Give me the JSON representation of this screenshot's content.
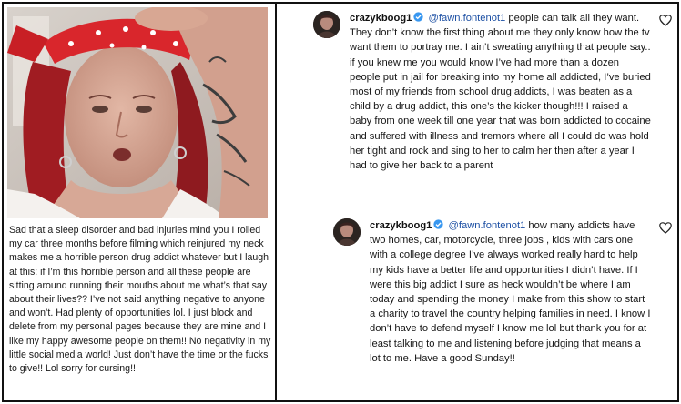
{
  "left_post": {
    "caption": "Sad that a sleep disorder and bad injuries mind you I rolled my car three months before filming which reinjured my neck makes me a horrible person drug addict whatever but I laugh at this: if I’m this horrible person and all these people are sitting around running their mouths about me what’s that say about their lives?? I’ve not said anything negative to anyone and won’t. Had plenty of opportunities lol. I just block and delete from my personal pages because they are mine and I like my happy awesome people on them!! No negativity in my little social media world! Just don’t have the time or the fucks to give!! Lol sorry for cursing!!"
  },
  "comments": [
    {
      "username": "crazykboog1",
      "mention": "@fawn.fontenot1",
      "text": "people can talk all they want. They don’t know the first thing about me they only know how the tv want them to portray me. I ain’t sweating anything that people say.. if you knew me you would know I’ve had more than a dozen people put in jail for breaking into my home all addicted, I’ve buried most of my friends from school drug addicts, I was beaten as a child by a drug addict, this one’s the kicker though!!! I raised a baby from one week till one year that was born addicted to cocaine and suffered with illness and tremors where all I could do was hold her tight and rock and sing to her to calm her then after a year I had to give her back to a parent"
    },
    {
      "username": "crazykboog1",
      "mention": "@fawn.fontenot1",
      "text": "how many addicts have two homes, car, motorcycle, three jobs , kids with cars one with a college degree I’ve always worked really hard to help my kids have a better life and opportunities I didn’t have. If I were this big addict I sure as heck wouldn’t be where I am today and spending the money I make from this show to start a charity to travel the country helping families in need. I know I don’t have to defend myself I know me lol but thank you for at least talking to me and listening before judging that means a lot to me. Have a good Sunday!!"
    }
  ],
  "colors": {
    "verified": "#3897f0",
    "mention": "#1c4fa3",
    "text": "#161616",
    "bandana": "#d9262c",
    "hair": "#a01c22"
  },
  "icons": {
    "verified": "verified-badge-icon",
    "like": "heart-icon"
  }
}
